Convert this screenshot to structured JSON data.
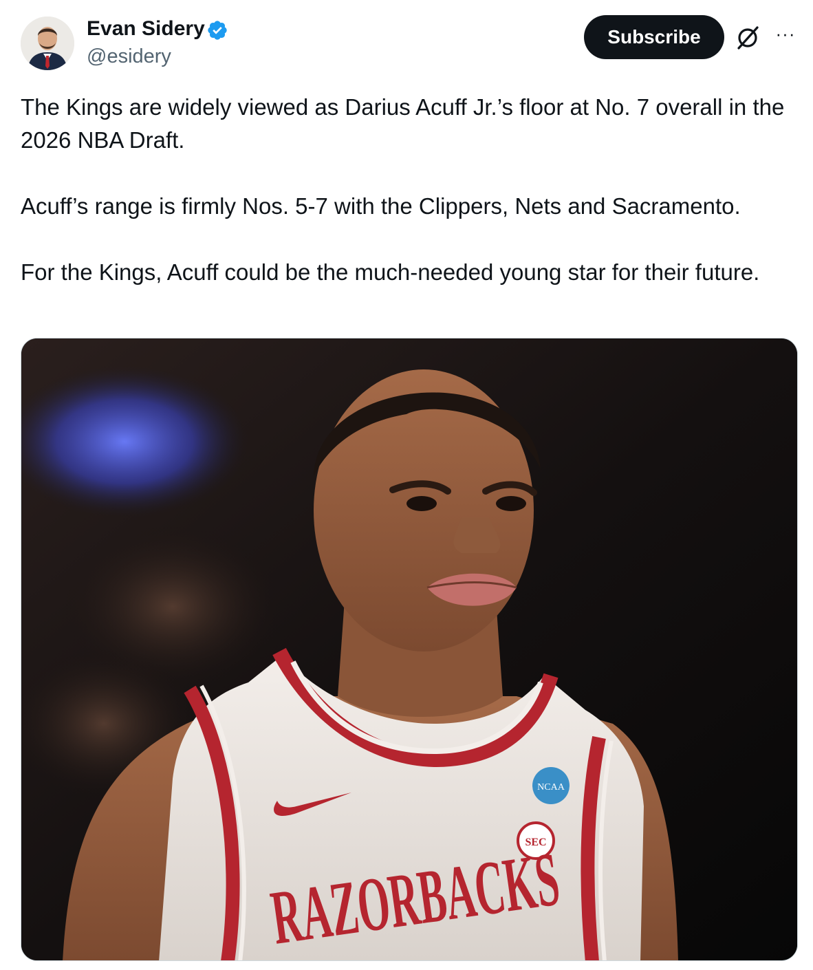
{
  "author": {
    "display_name": "Evan Sidery",
    "handle": "@esidery",
    "verified": true,
    "verified_color": "#1d9bf0"
  },
  "actions": {
    "subscribe_label": "Subscribe",
    "grok_icon": "grok-icon",
    "more_icon": "more-icon",
    "more_label": "···"
  },
  "tweet": {
    "paragraphs": [
      "The Kings are widely viewed as Darius Acuff Jr.’s floor at No. 7 overall in the 2026 NBA Draft.",
      "Acuff’s range is firmly Nos. 5-7 with the Clippers, Nets and Sacramento.",
      "For the Kings, Acuff could be the much-needed young star for their future."
    ]
  },
  "media": {
    "jersey_text": "RAZORBACKS",
    "patch_ncaa": "NCAA",
    "patch_sec": "SEC",
    "jersey_trim_color": "#b5252f"
  }
}
